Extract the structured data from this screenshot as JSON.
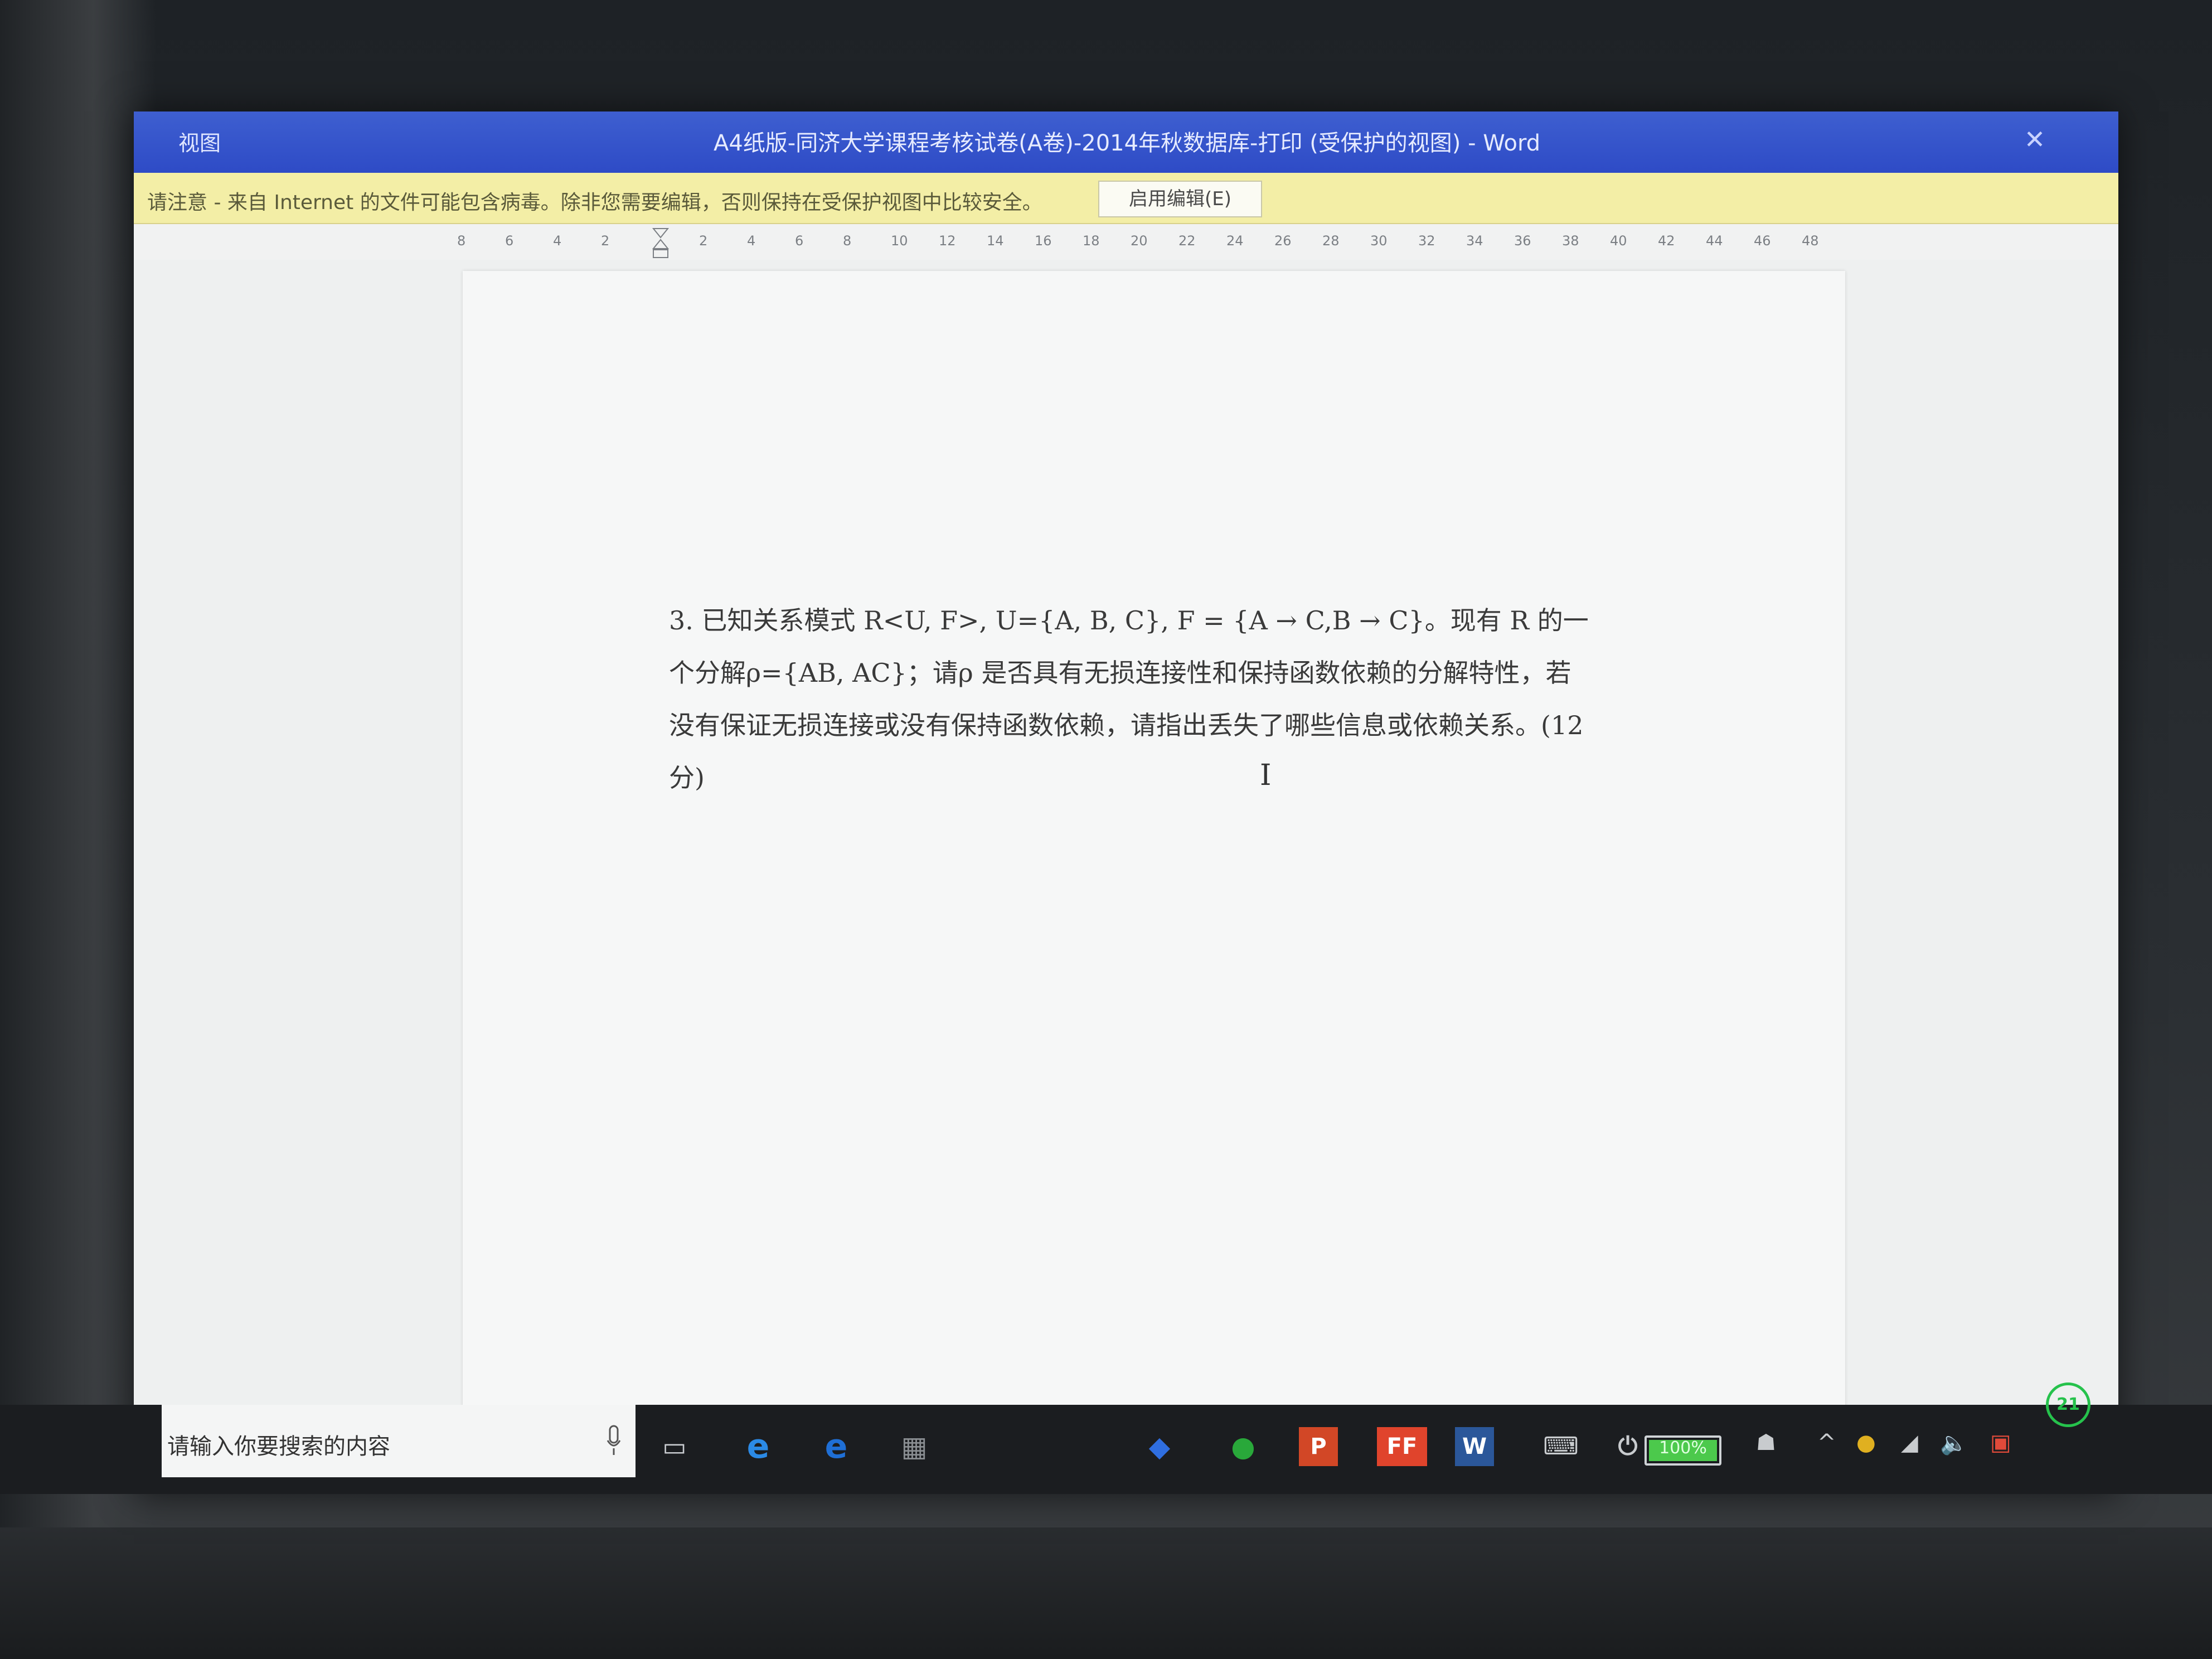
{
  "window": {
    "menu_label": "视图",
    "title": "A4纸版-同济大学课程考核试卷(A卷)-2014年秋数据库-打印 (受保护的视图) - Word",
    "close_icon": "close-icon"
  },
  "protected_view": {
    "message": "请注意 - 来自 Internet 的文件可能包含病毒。除非您需要编辑，否则保持在受保护视图中比较安全。",
    "enable_button": "启用编辑(E)"
  },
  "ruler": {
    "ticks": [
      "8",
      "6",
      "4",
      "2",
      "2",
      "4",
      "6",
      "8",
      "10",
      "12",
      "14",
      "16",
      "18",
      "20",
      "22",
      "24",
      "26",
      "28",
      "30",
      "32",
      "34",
      "36",
      "38",
      "40",
      "42",
      "44",
      "46",
      "48"
    ]
  },
  "document": {
    "question_lines": [
      "3. 已知关系模式 R<U, F>, U={A, B, C}, F = {A → C,B → C}。现有 R 的一",
      "个分解ρ={AB, AC}；请ρ 是否具有无损连接性和保持函数依赖的分解特性，若",
      "没有保证无损连接或没有保持函数依赖，请指出丢失了哪些信息或依赖关系。(12",
      "分)"
    ],
    "cursor_glyph": "I"
  },
  "taskbar": {
    "search_placeholder": "请输入你要搜索的内容",
    "battery_label": "100%",
    "powerpoint_label": "P",
    "foxit_label": "FF",
    "word_label": "W",
    "clock_badge": "21"
  },
  "colors": {
    "title_blue": "#2e4bc6",
    "protected_yellow": "#f3eea6",
    "taskbar_dark": "#1b1d20",
    "powerpoint_red": "#d24726",
    "foxit_red": "#e0442c",
    "word_blue": "#2b579a",
    "battery_green": "#4cc94c"
  }
}
